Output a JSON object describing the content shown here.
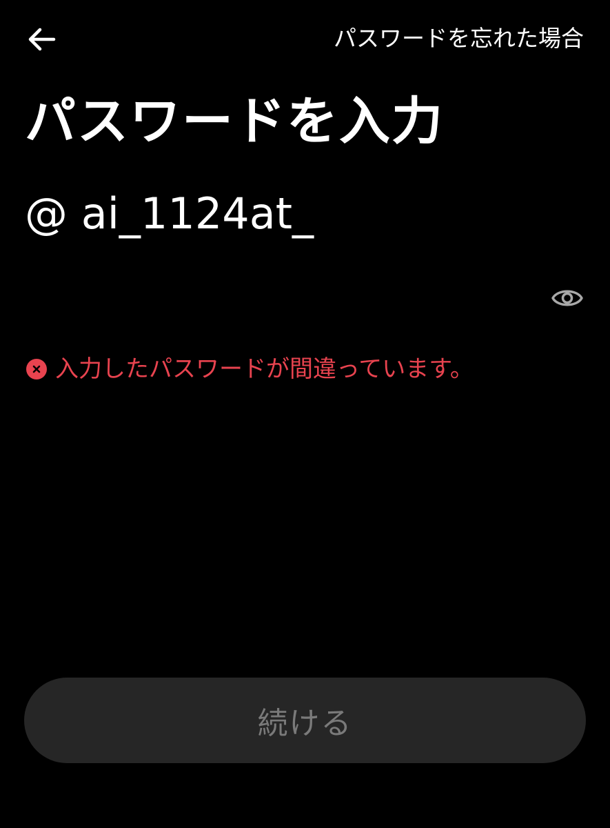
{
  "header": {
    "back_icon": "arrow-left-icon",
    "forgot_password_label": "パスワードを忘れた場合"
  },
  "main": {
    "title": "パスワードを入力",
    "username": "@ ai_1124at_",
    "password": {
      "value": "",
      "visibility_icon": "eye-icon"
    },
    "error": {
      "icon": "error-x-icon",
      "message": "入力したパスワードが間違っています。"
    }
  },
  "footer": {
    "continue_label": "続ける"
  },
  "colors": {
    "background": "#000000",
    "text": "#ffffff",
    "error": "#e8434f",
    "button_bg": "#262626",
    "button_text": "#7a7a7a",
    "icon_muted": "#a8a8a8"
  }
}
